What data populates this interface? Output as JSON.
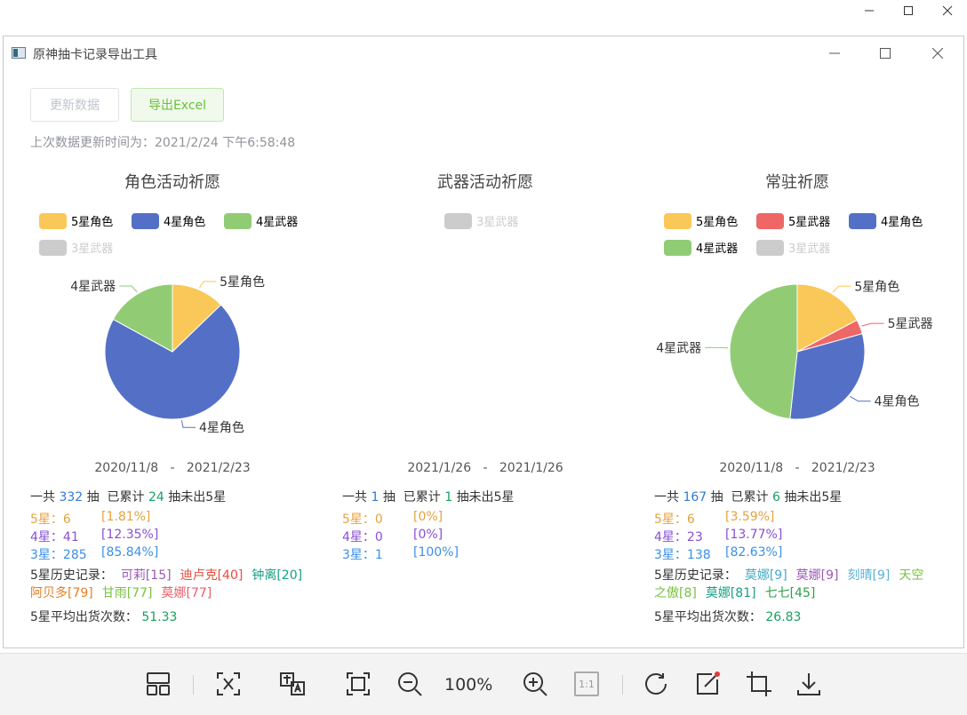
{
  "window": {
    "title": "原神抽卡记录导出工具"
  },
  "toolbar": {
    "update_label": "更新数据",
    "export_label": "导出Excel"
  },
  "last_update": "上次数据更新时间为：2021/2/24 下午6:58:48",
  "colors": {
    "star5_char": "#fac858",
    "star4_char": "#5470c6",
    "star4_weapon": "#91cc75",
    "star3_weapon": "#cccccc",
    "star5_weapon": "#ee6666"
  },
  "legend_labels": {
    "star5_char": "5星角色",
    "star5_weapon": "5星武器",
    "star4_char": "4星角色",
    "star4_weapon": "4星武器",
    "star3_weapon": "3星武器"
  },
  "common": {
    "total_prefix": "一共",
    "pull_unit": "抽",
    "since_prefix": "已累计",
    "since_suffix": "抽未出5星",
    "star5": "5星：",
    "star4": "4星：",
    "star3": "3星：",
    "history_label": "5星历史记录：",
    "avg_label": "5星平均出货次数：",
    "date_sep": "-"
  },
  "panels": [
    {
      "title": "角色活动祈愿",
      "date_start": "2020/11/8",
      "date_end": "2021/2/23",
      "total": "332",
      "since": "24",
      "s5_count": "6",
      "s5_pct": "[1.81%]",
      "s4_count": "41",
      "s4_pct": "[12.35%]",
      "s3_count": "285",
      "s3_pct": "[85.84%]",
      "history": [
        {
          "name": "可莉[15]",
          "color": "#9b59b6"
        },
        {
          "name": "迪卢克[40]",
          "color": "#e74c3c"
        },
        {
          "name": "钟离[20]",
          "color": "#16a085"
        },
        {
          "name": "阿贝多[79]",
          "color": "#e67e22"
        },
        {
          "name": "甘雨[77]",
          "color": "#7ac143"
        },
        {
          "name": "莫娜[77]",
          "color": "#e8606a"
        }
      ],
      "avg": "51.33"
    },
    {
      "title": "武器活动祈愿",
      "date_start": "2021/1/26",
      "date_end": "2021/1/26",
      "total": "1",
      "since": "1",
      "s5_count": "0",
      "s5_pct": "[0%]",
      "s4_count": "0",
      "s4_pct": "[0%]",
      "s3_count": "1",
      "s3_pct": "[100%]"
    },
    {
      "title": "常驻祈愿",
      "date_start": "2020/11/8",
      "date_end": "2021/2/23",
      "total": "167",
      "since": "6",
      "s5_count": "6",
      "s5_pct": "[3.59%]",
      "s4_count": "23",
      "s4_pct": "[13.77%]",
      "s3_count": "138",
      "s3_pct": "[82.63%]",
      "history_line1": [
        {
          "name": "莫娜[9]",
          "color": "#46a9c8"
        },
        {
          "name": "莫娜[9]",
          "color": "#9b59b6"
        },
        {
          "name": "刻晴[9]",
          "color": "#5bb2d6"
        },
        {
          "name": "天空",
          "color": "#7ac143"
        }
      ],
      "history_line2": [
        {
          "name": "之傲[8]",
          "color": "#7ac143"
        },
        {
          "name": "莫娜[81]",
          "color": "#16a085"
        },
        {
          "name": "七七[45]",
          "color": "#2d9e4a"
        }
      ],
      "avg": "26.83"
    }
  ],
  "chart_data": [
    {
      "type": "pie",
      "title": "角色活动祈愿",
      "legend": [
        "5星角色",
        "4星角色",
        "4星武器",
        "3星武器"
      ],
      "visible_slices": [
        {
          "label": "5星角色",
          "value": 6
        },
        {
          "label": "4星角色",
          "value": 33
        },
        {
          "label": "4星武器",
          "value": 8
        }
      ],
      "hidden_series": [
        "3星武器"
      ]
    },
    {
      "type": "pie",
      "title": "武器活动祈愿",
      "legend": [
        "3星武器"
      ],
      "visible_slices": [],
      "hidden_series": [
        "3星武器"
      ]
    },
    {
      "type": "pie",
      "title": "常驻祈愿",
      "legend": [
        "5星角色",
        "5星武器",
        "4星角色",
        "4星武器",
        "3星武器"
      ],
      "visible_slices": [
        {
          "label": "5星角色",
          "value": 5
        },
        {
          "label": "5星武器",
          "value": 1
        },
        {
          "label": "4星角色",
          "value": 9
        },
        {
          "label": "4星武器",
          "value": 14
        }
      ],
      "hidden_series": [
        "3星武器"
      ]
    }
  ],
  "viewer": {
    "zoom": "100%",
    "actual_size": "1:1"
  }
}
